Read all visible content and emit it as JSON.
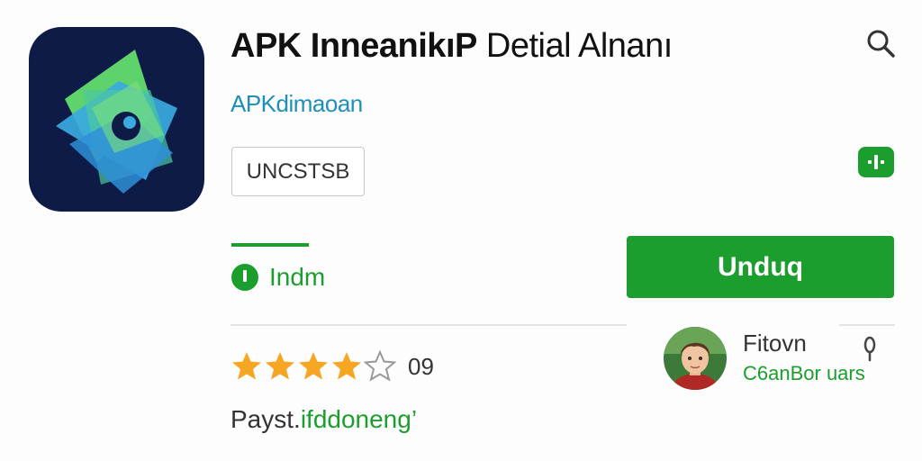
{
  "app": {
    "title_main": "APK InneanikıP",
    "title_light": " Detial Alnanı",
    "developer": "APKdimaoan",
    "badge": "UNCSTSB"
  },
  "tabs": {
    "install_label": "Indm"
  },
  "actions": {
    "download_label": "Unduq"
  },
  "rating": {
    "stars_filled": 4,
    "stars_total": 5,
    "count": "09"
  },
  "payment": {
    "prefix": "Payst.",
    "link": "ifddoneng’"
  },
  "review": {
    "name": "Fitovn",
    "subtitle": "C6anBor uars"
  },
  "icons": {
    "search": "search-icon",
    "app_logo": "app-logo-icon",
    "install": "install-icon",
    "more": "more-vertical-icon",
    "star": "star-icon"
  },
  "colors": {
    "accent_green": "#1c9e2e",
    "link_blue": "#1f8fb8",
    "app_icon_bg": "#0d1b46",
    "star_gold": "#f5a623"
  }
}
